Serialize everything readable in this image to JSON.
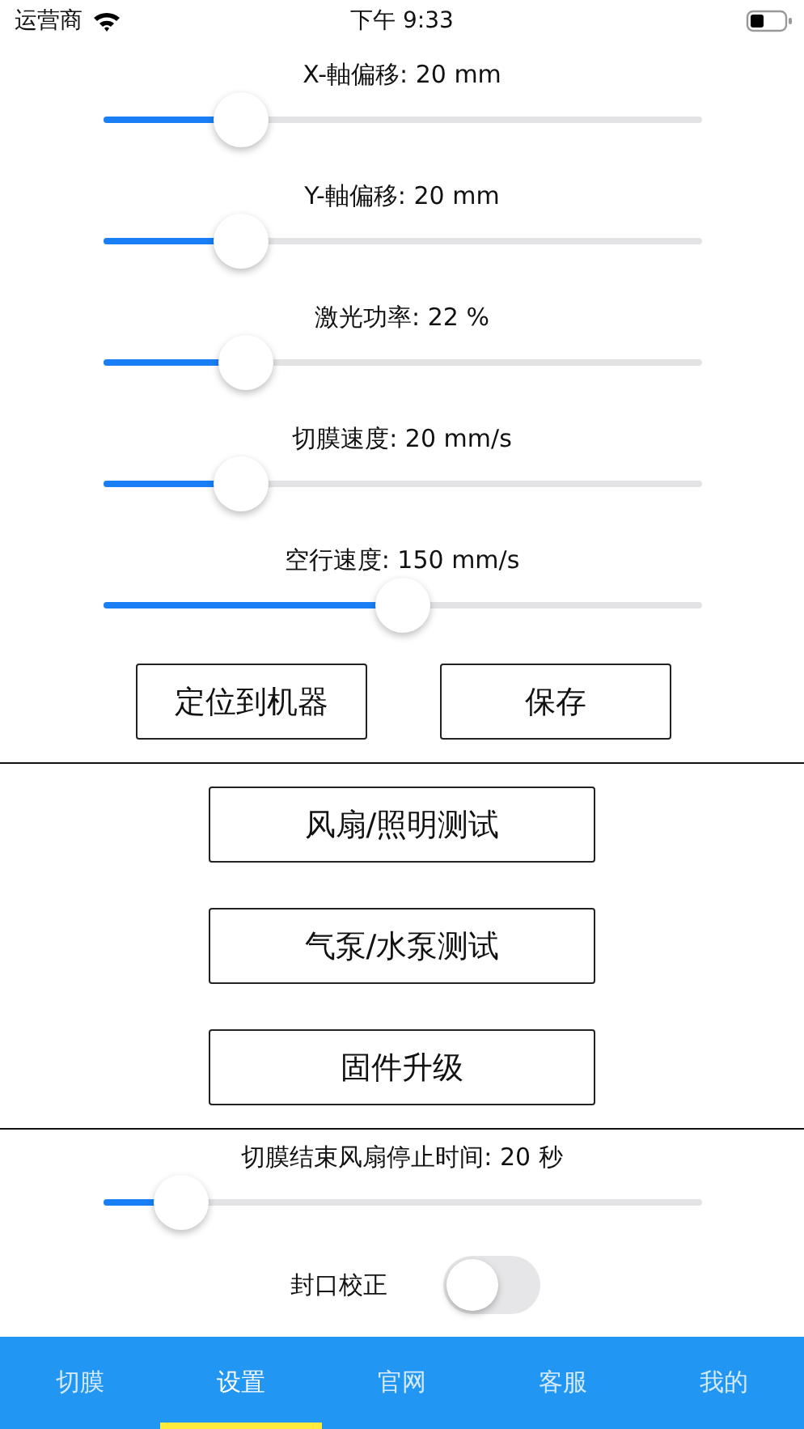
{
  "status_bar": {
    "carrier": "运营商",
    "time": "下午 9:33"
  },
  "sliders": [
    {
      "label": "X-軸偏移: 20 mm",
      "level": 0.23
    },
    {
      "label": "Y-軸偏移: 20 mm",
      "level": 0.23
    },
    {
      "label": "激光功率: 22 %",
      "level": 0.24
    },
    {
      "label": "切膜速度: 20 mm/s",
      "level": 0.23
    },
    {
      "label": "空行速度: 150 mm/s",
      "level": 0.5
    }
  ],
  "action_buttons": [
    "定位到机器",
    "保存"
  ],
  "test_buttons": [
    "风扇/照明测试",
    "气泵/水泵测试",
    "固件升级"
  ],
  "fan_slider": {
    "label": "切膜结束风扇停止时间: 20 秒",
    "level": 0.13
  },
  "seal_toggle": {
    "label": "封口校正",
    "on": false
  },
  "tabs": [
    {
      "label": "切膜",
      "selected": false
    },
    {
      "label": "设置",
      "selected": true
    },
    {
      "label": "官网",
      "selected": false
    },
    {
      "label": "客服",
      "selected": false
    },
    {
      "label": "我的",
      "selected": false
    }
  ]
}
